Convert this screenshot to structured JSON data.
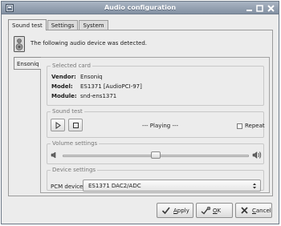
{
  "window": {
    "title": "Audio configuration"
  },
  "tabs": [
    {
      "label": "Sound test",
      "active": true
    },
    {
      "label": "Settings",
      "active": false
    },
    {
      "label": "System",
      "active": false
    }
  ],
  "detected_message": "The following audio device was detected.",
  "device_tab": "Ensoniq",
  "selected_card": {
    "label": "Selected card",
    "vendor_key": "Vendor:",
    "vendor": "Ensoniq",
    "model_key": "Model:",
    "model": "ES1371 [AudioPCI-97]",
    "module_key": "Module:",
    "module": "snd-ens1371"
  },
  "sound_test": {
    "label": "Sound test",
    "status": "--- Playing ---",
    "repeat_label": "Repeat",
    "repeat_checked": false
  },
  "volume": {
    "label": "Volume settings",
    "level": 0.5
  },
  "device_settings": {
    "label": "Device settings",
    "pcm_label": "PCM device",
    "pcm_value": "ES1371 DAC2/ADC"
  },
  "buttons": {
    "apply": {
      "label": "Apply",
      "mnemonic": "A"
    },
    "ok": {
      "label": "OK",
      "mnemonic": "O"
    },
    "cancel": {
      "label": "Cancel",
      "mnemonic": "C"
    }
  },
  "icons": {
    "window": "window-icon",
    "minimize": "minimize-icon",
    "maximize": "maximize-icon",
    "close": "close-icon",
    "speaker": "speaker-icon",
    "play": "play-icon",
    "stop": "stop-icon",
    "volume_low": "volume-low-icon",
    "volume_high": "volume-high-icon",
    "apply": "checkmark-icon",
    "ok": "ok-icon",
    "cancel": "cancel-x-icon"
  },
  "colors": {
    "titlebar": "#8f9cad",
    "background": "#ececec"
  }
}
